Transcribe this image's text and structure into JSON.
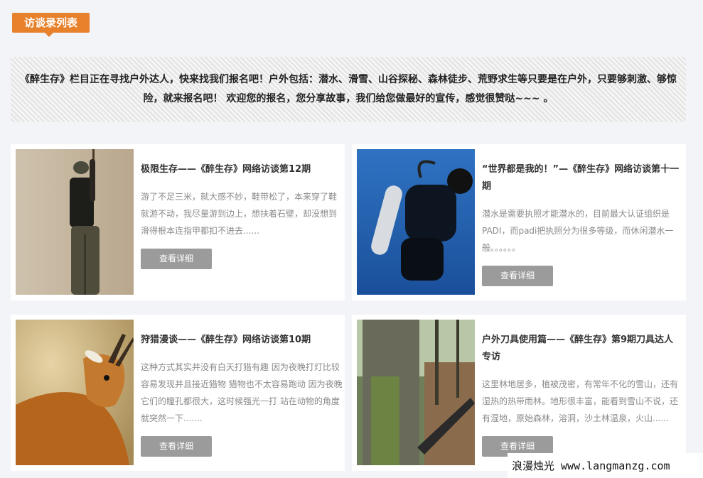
{
  "section": {
    "title": "访谈录列表"
  },
  "intro": {
    "text": "《醉生存》栏目正在寻找户外达人，快来找我们报名吧！户外包括：潜水、滑雪、山谷探秘、森林徒步、荒野求生等只要是在户外，只要够刺激、够惊险，就来报名吧！ 欢迎您的报名，您分享故事，我们给您做最好的宣传，感觉很赞哒~~~ 。"
  },
  "cards": [
    {
      "title": "极限生存——《醉生存》网络访谈第12期",
      "desc": "游了不足三米，就大感不妙，鞋带松了，本来穿了鞋就游不动，我尽量游到边上，想扶着石壁，却没想到滑得根本连指甲都扣不进去......",
      "button": "查看详细",
      "image_icon": "climber-photo"
    },
    {
      "title": "“世界都是我的！”—《醉生存》网络访谈第十一期",
      "desc": "潜水是需要执照才能潜水的，目前最大认证组织是PADI，而padi把执照分为很多等级，而休闲潜水一般。。。。。。",
      "button": "查看详细",
      "image_icon": "diver-photo"
    },
    {
      "title": "狩猎漫谈——《醉生存》网络访谈第10期",
      "desc": "这种方式其实并没有白天打猎有趣 因为夜晚打灯比较容易发现并且接近猎物 猎物也不太容易跑动 因为夜晚它们的瞳孔都很大，这时候强光一打 站在动物的角度就突然一下.......",
      "button": "查看详细",
      "image_icon": "antelope-photo"
    },
    {
      "title": "户外刀具使用篇——《醉生存》第9期刀具达人专访",
      "desc": "这里林地居多，植被茂密，有常年不化的雪山，还有湿热的热带雨林。地形很丰富，能看到雪山不说，还有湿地，原始森林，溶洞，沙土林温泉，火山......",
      "button": "查看详细",
      "image_icon": "forest-knife-photo"
    }
  ],
  "watermark": {
    "text": "浪漫烛光 www.langmanzg.com"
  }
}
